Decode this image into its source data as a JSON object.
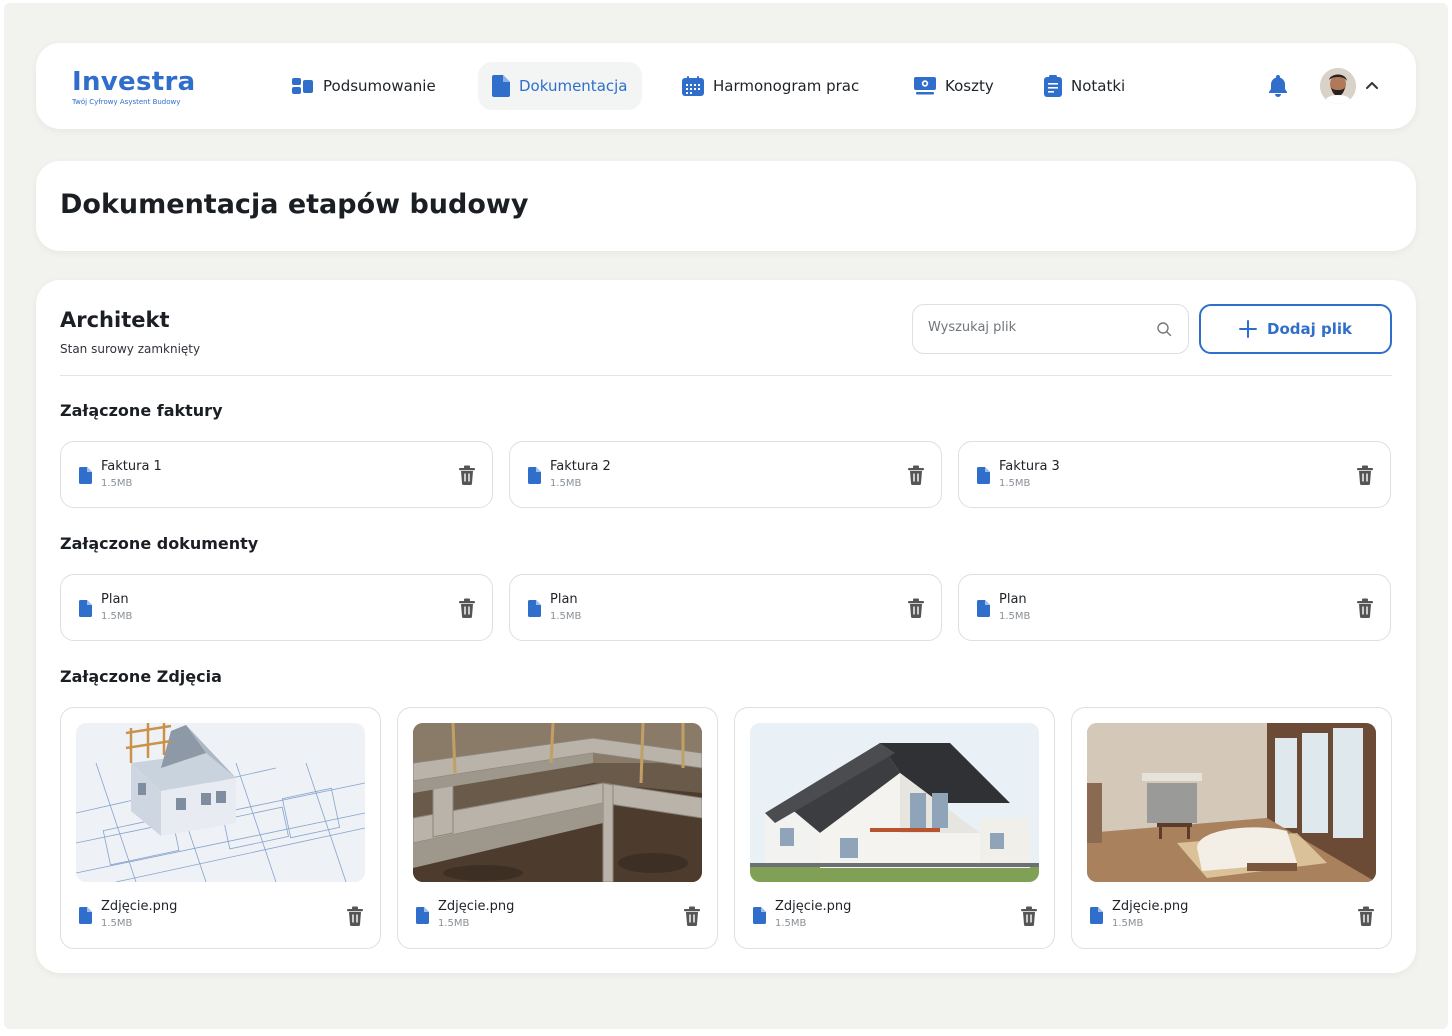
{
  "app": {
    "logo_title": "Investra",
    "logo_subtitle": "Twój Cyfrowy Asystent Budowy"
  },
  "nav": {
    "items": [
      {
        "label": "Podsumowanie",
        "icon": "dashboard-icon",
        "active": false
      },
      {
        "label": "Dokumentacja",
        "icon": "document-icon",
        "active": true
      },
      {
        "label": "Harmonogram prac",
        "icon": "calendar-icon",
        "active": false
      },
      {
        "label": "Koszty",
        "icon": "money-icon",
        "active": false
      },
      {
        "label": "Notatki",
        "icon": "notes-icon",
        "active": false
      }
    ]
  },
  "page": {
    "title": "Dokumentacja etapów budowy"
  },
  "section": {
    "title": "Architekt",
    "subtitle": "Stan surowy zamknięty",
    "search_placeholder": "Wyszukaj plik",
    "add_button_label": "Dodaj plik"
  },
  "invoices": {
    "title": "Załączone faktury",
    "files": [
      {
        "name": "Faktura 1",
        "size": "1.5MB"
      },
      {
        "name": "Faktura 2",
        "size": "1.5MB"
      },
      {
        "name": "Faktura 3",
        "size": "1.5MB"
      }
    ]
  },
  "documents": {
    "title": "Załączone dokumenty",
    "files": [
      {
        "name": "Plan",
        "size": "1.5MB"
      },
      {
        "name": "Plan",
        "size": "1.5MB"
      },
      {
        "name": "Plan",
        "size": "1.5MB"
      }
    ]
  },
  "photos": {
    "title": "Załączone Zdjęcia",
    "files": [
      {
        "name": "Zdjęcie.png",
        "size": "1.5MB",
        "image": "house-model-on-blueprints"
      },
      {
        "name": "Zdjęcie.png",
        "size": "1.5MB",
        "image": "concrete-foundation"
      },
      {
        "name": "Zdjęcie.png",
        "size": "1.5MB",
        "image": "finished-house-exterior"
      },
      {
        "name": "Zdjęcie.png",
        "size": "1.5MB",
        "image": "living-room-interior"
      }
    ]
  },
  "colors": {
    "accent": "#2f6fcb",
    "background": "#f2f2ef",
    "card": "#ffffff",
    "border": "#dcdfe3"
  }
}
